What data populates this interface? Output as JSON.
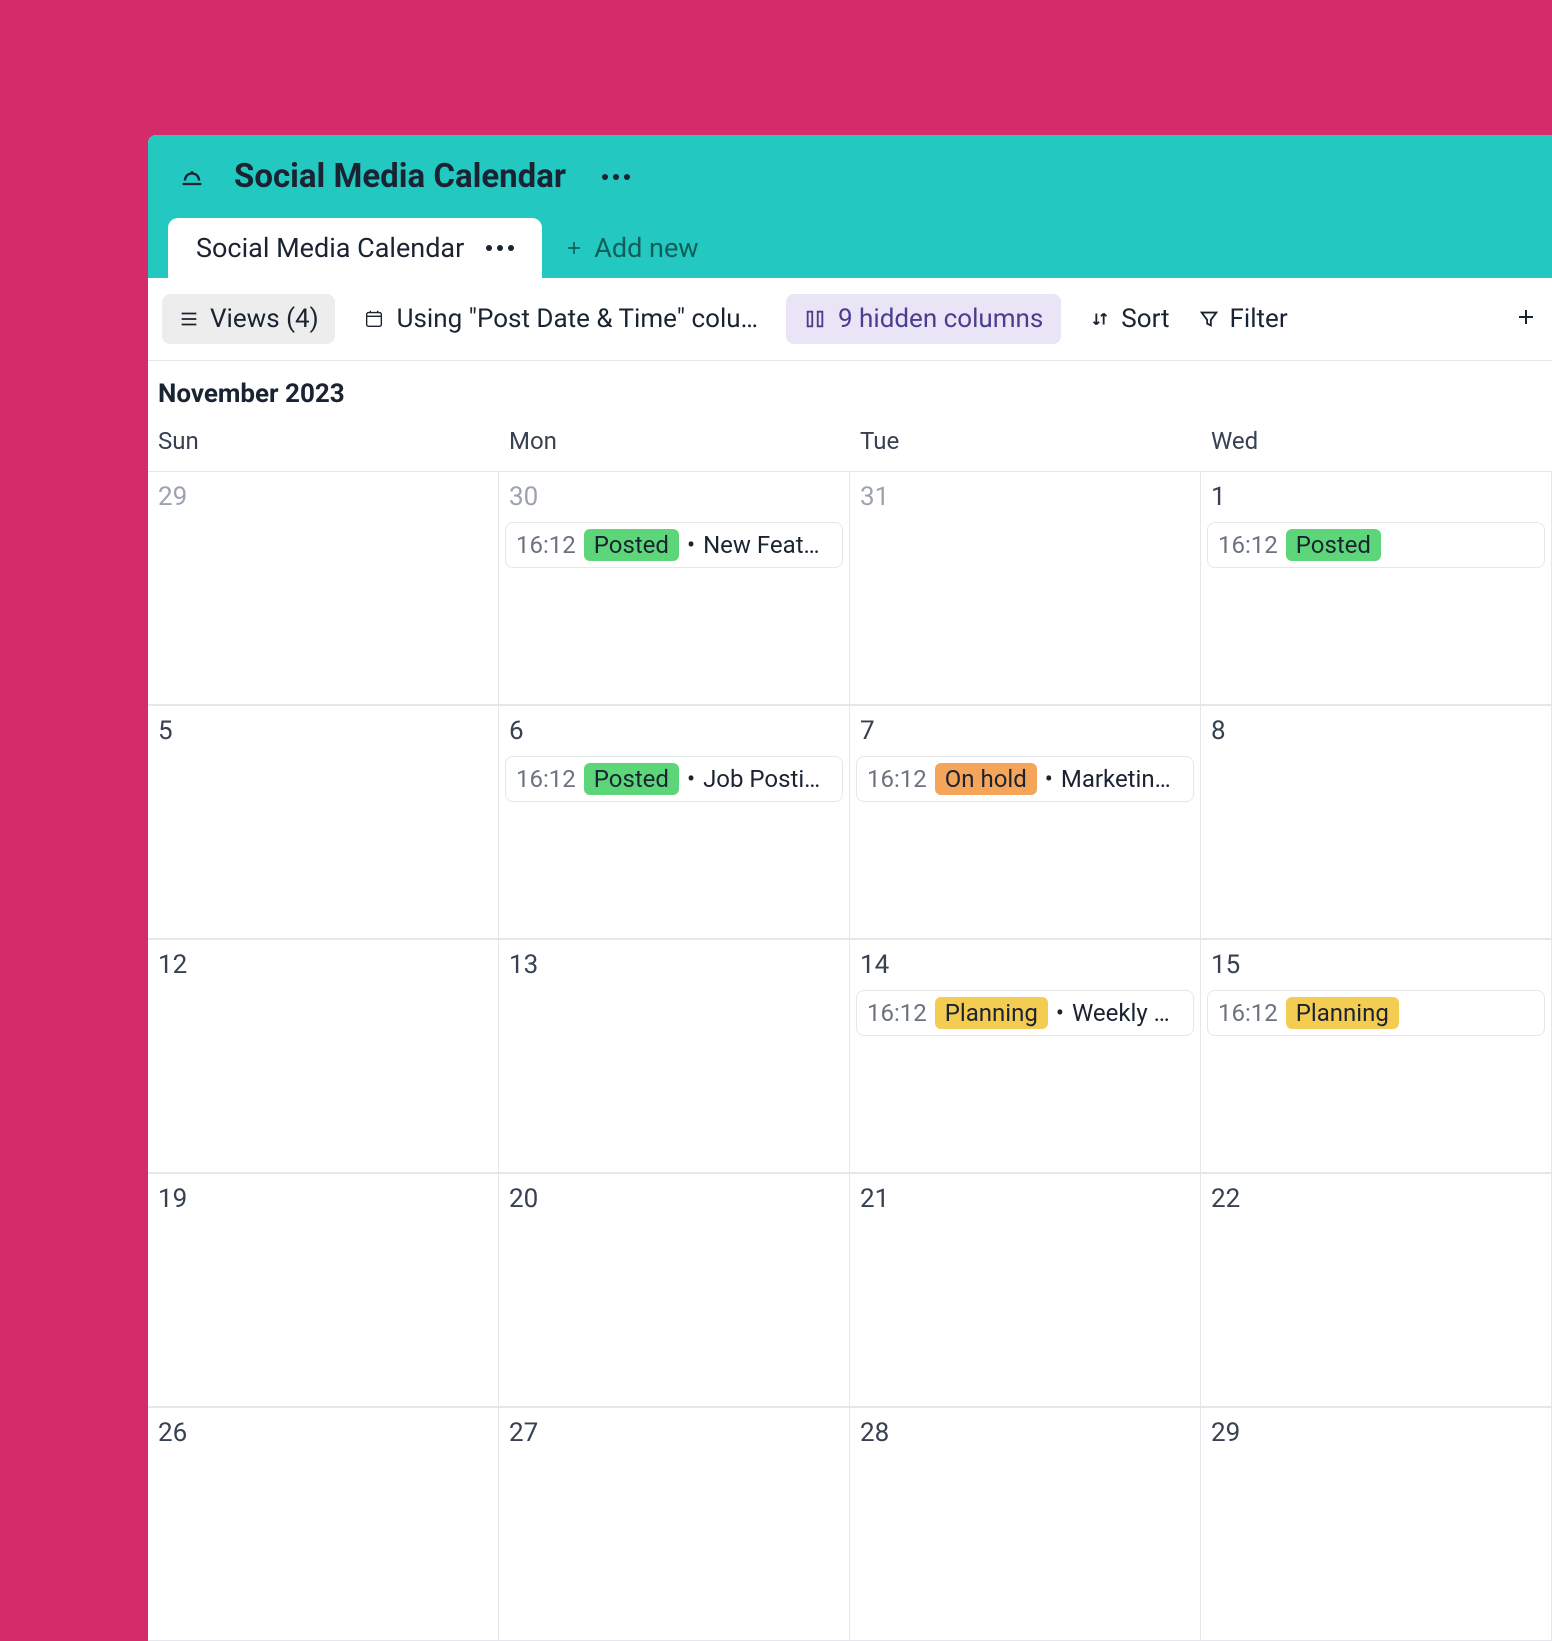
{
  "header": {
    "title": "Social Media Calendar"
  },
  "tabs": {
    "active_label": "Social Media Calendar",
    "add_new_label": "Add new"
  },
  "toolbar": {
    "views_label": "Views (4)",
    "column_indicator": "Using \"Post Date & Time\" colu…",
    "hidden_columns_label": "9 hidden columns",
    "sort_label": "Sort",
    "filter_label": "Filter"
  },
  "calendar": {
    "month_label": "November 2023",
    "day_headers": [
      "Sun",
      "Mon",
      "Tue",
      "Wed"
    ],
    "cells": [
      {
        "date": "29",
        "faded": true,
        "events": []
      },
      {
        "date": "30",
        "faded": true,
        "events": [
          {
            "time": "16:12",
            "status": "Posted",
            "status_class": "badge-posted",
            "title": "New Feat…"
          }
        ]
      },
      {
        "date": "31",
        "faded": true,
        "events": []
      },
      {
        "date": "1",
        "faded": false,
        "events": [
          {
            "time": "16:12",
            "status": "Posted",
            "status_class": "badge-posted",
            "title": ""
          }
        ]
      },
      {
        "date": "5",
        "faded": false,
        "events": []
      },
      {
        "date": "6",
        "faded": false,
        "events": [
          {
            "time": "16:12",
            "status": "Posted",
            "status_class": "badge-posted",
            "title": "Job Posti…"
          }
        ]
      },
      {
        "date": "7",
        "faded": false,
        "events": [
          {
            "time": "16:12",
            "status": "On hold",
            "status_class": "badge-onhold",
            "title": "Marketin…"
          }
        ]
      },
      {
        "date": "8",
        "faded": false,
        "events": []
      },
      {
        "date": "12",
        "faded": false,
        "events": []
      },
      {
        "date": "13",
        "faded": false,
        "events": []
      },
      {
        "date": "14",
        "faded": false,
        "events": [
          {
            "time": "16:12",
            "status": "Planning",
            "status_class": "badge-planning",
            "title": "Weekly …"
          }
        ]
      },
      {
        "date": "15",
        "faded": false,
        "events": [
          {
            "time": "16:12",
            "status": "Planning",
            "status_class": "badge-planning",
            "title": ""
          }
        ]
      },
      {
        "date": "19",
        "faded": false,
        "events": []
      },
      {
        "date": "20",
        "faded": false,
        "events": []
      },
      {
        "date": "21",
        "faded": false,
        "events": []
      },
      {
        "date": "22",
        "faded": false,
        "events": []
      },
      {
        "date": "26",
        "faded": false,
        "events": []
      },
      {
        "date": "27",
        "faded": false,
        "events": []
      },
      {
        "date": "28",
        "faded": false,
        "events": []
      },
      {
        "date": "29",
        "faded": false,
        "events": []
      }
    ]
  }
}
